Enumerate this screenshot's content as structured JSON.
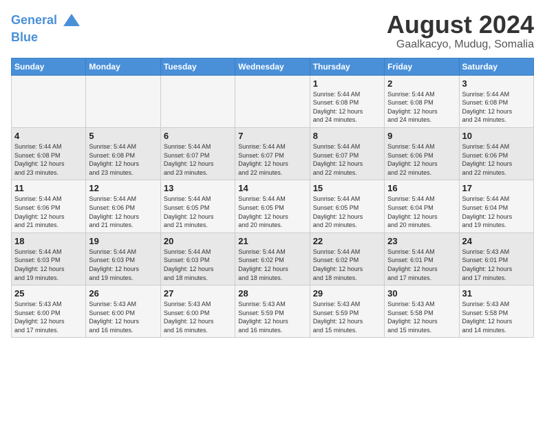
{
  "header": {
    "logo_line1": "General",
    "logo_line2": "Blue",
    "month_title": "August 2024",
    "subtitle": "Gaalkacyo, Mudug, Somalia"
  },
  "weekdays": [
    "Sunday",
    "Monday",
    "Tuesday",
    "Wednesday",
    "Thursday",
    "Friday",
    "Saturday"
  ],
  "weeks": [
    [
      {
        "day": "",
        "info": ""
      },
      {
        "day": "",
        "info": ""
      },
      {
        "day": "",
        "info": ""
      },
      {
        "day": "",
        "info": ""
      },
      {
        "day": "1",
        "info": "Sunrise: 5:44 AM\nSunset: 6:08 PM\nDaylight: 12 hours\nand 24 minutes."
      },
      {
        "day": "2",
        "info": "Sunrise: 5:44 AM\nSunset: 6:08 PM\nDaylight: 12 hours\nand 24 minutes."
      },
      {
        "day": "3",
        "info": "Sunrise: 5:44 AM\nSunset: 6:08 PM\nDaylight: 12 hours\nand 24 minutes."
      }
    ],
    [
      {
        "day": "4",
        "info": "Sunrise: 5:44 AM\nSunset: 6:08 PM\nDaylight: 12 hours\nand 23 minutes."
      },
      {
        "day": "5",
        "info": "Sunrise: 5:44 AM\nSunset: 6:08 PM\nDaylight: 12 hours\nand 23 minutes."
      },
      {
        "day": "6",
        "info": "Sunrise: 5:44 AM\nSunset: 6:07 PM\nDaylight: 12 hours\nand 23 minutes."
      },
      {
        "day": "7",
        "info": "Sunrise: 5:44 AM\nSunset: 6:07 PM\nDaylight: 12 hours\nand 22 minutes."
      },
      {
        "day": "8",
        "info": "Sunrise: 5:44 AM\nSunset: 6:07 PM\nDaylight: 12 hours\nand 22 minutes."
      },
      {
        "day": "9",
        "info": "Sunrise: 5:44 AM\nSunset: 6:06 PM\nDaylight: 12 hours\nand 22 minutes."
      },
      {
        "day": "10",
        "info": "Sunrise: 5:44 AM\nSunset: 6:06 PM\nDaylight: 12 hours\nand 22 minutes."
      }
    ],
    [
      {
        "day": "11",
        "info": "Sunrise: 5:44 AM\nSunset: 6:06 PM\nDaylight: 12 hours\nand 21 minutes."
      },
      {
        "day": "12",
        "info": "Sunrise: 5:44 AM\nSunset: 6:06 PM\nDaylight: 12 hours\nand 21 minutes."
      },
      {
        "day": "13",
        "info": "Sunrise: 5:44 AM\nSunset: 6:05 PM\nDaylight: 12 hours\nand 21 minutes."
      },
      {
        "day": "14",
        "info": "Sunrise: 5:44 AM\nSunset: 6:05 PM\nDaylight: 12 hours\nand 20 minutes."
      },
      {
        "day": "15",
        "info": "Sunrise: 5:44 AM\nSunset: 6:05 PM\nDaylight: 12 hours\nand 20 minutes."
      },
      {
        "day": "16",
        "info": "Sunrise: 5:44 AM\nSunset: 6:04 PM\nDaylight: 12 hours\nand 20 minutes."
      },
      {
        "day": "17",
        "info": "Sunrise: 5:44 AM\nSunset: 6:04 PM\nDaylight: 12 hours\nand 19 minutes."
      }
    ],
    [
      {
        "day": "18",
        "info": "Sunrise: 5:44 AM\nSunset: 6:03 PM\nDaylight: 12 hours\nand 19 minutes."
      },
      {
        "day": "19",
        "info": "Sunrise: 5:44 AM\nSunset: 6:03 PM\nDaylight: 12 hours\nand 19 minutes."
      },
      {
        "day": "20",
        "info": "Sunrise: 5:44 AM\nSunset: 6:03 PM\nDaylight: 12 hours\nand 18 minutes."
      },
      {
        "day": "21",
        "info": "Sunrise: 5:44 AM\nSunset: 6:02 PM\nDaylight: 12 hours\nand 18 minutes."
      },
      {
        "day": "22",
        "info": "Sunrise: 5:44 AM\nSunset: 6:02 PM\nDaylight: 12 hours\nand 18 minutes."
      },
      {
        "day": "23",
        "info": "Sunrise: 5:44 AM\nSunset: 6:01 PM\nDaylight: 12 hours\nand 17 minutes."
      },
      {
        "day": "24",
        "info": "Sunrise: 5:43 AM\nSunset: 6:01 PM\nDaylight: 12 hours\nand 17 minutes."
      }
    ],
    [
      {
        "day": "25",
        "info": "Sunrise: 5:43 AM\nSunset: 6:00 PM\nDaylight: 12 hours\nand 17 minutes."
      },
      {
        "day": "26",
        "info": "Sunrise: 5:43 AM\nSunset: 6:00 PM\nDaylight: 12 hours\nand 16 minutes."
      },
      {
        "day": "27",
        "info": "Sunrise: 5:43 AM\nSunset: 6:00 PM\nDaylight: 12 hours\nand 16 minutes."
      },
      {
        "day": "28",
        "info": "Sunrise: 5:43 AM\nSunset: 5:59 PM\nDaylight: 12 hours\nand 16 minutes."
      },
      {
        "day": "29",
        "info": "Sunrise: 5:43 AM\nSunset: 5:59 PM\nDaylight: 12 hours\nand 15 minutes."
      },
      {
        "day": "30",
        "info": "Sunrise: 5:43 AM\nSunset: 5:58 PM\nDaylight: 12 hours\nand 15 minutes."
      },
      {
        "day": "31",
        "info": "Sunrise: 5:43 AM\nSunset: 5:58 PM\nDaylight: 12 hours\nand 14 minutes."
      }
    ]
  ]
}
